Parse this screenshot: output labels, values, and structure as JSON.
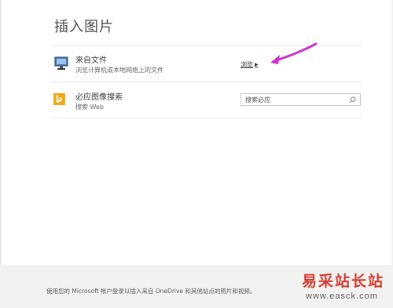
{
  "dialog": {
    "title": "插入图片"
  },
  "options": [
    {
      "icon": "computer-monitor-icon",
      "title": "来自文件",
      "subtitle": "浏览计算机或本地网络上的文件",
      "action_label": "浏览",
      "action_icon": "right-arrow-icon"
    },
    {
      "icon": "bing-logo-icon",
      "title": "必应图像搜索",
      "subtitle": "搜索 Web",
      "search_placeholder": "搜索必应",
      "search_icon": "search-icon"
    }
  ],
  "footer": {
    "text": "使用您的 Microsoft 帐户登录以插入来自 OneDrive 和其他站点的照片和视频。"
  },
  "watermark": {
    "name": "易采站长站",
    "url": "www.easck.com"
  },
  "colors": {
    "annotation_arrow": "#cc33cc",
    "bing_orange": "#f0a915",
    "footer_background": "#f2f2f2",
    "watermark_red": "#d23b2b"
  }
}
